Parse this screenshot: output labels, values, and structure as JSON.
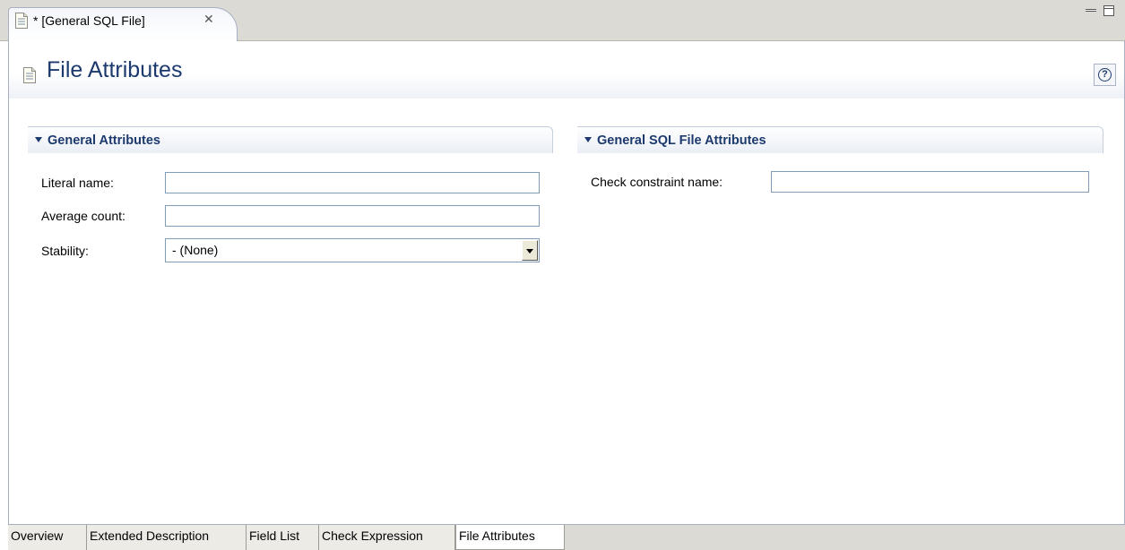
{
  "editor_tab": {
    "title": "* [General SQL File]",
    "close_glyph": "✕"
  },
  "view_controls": {
    "minimize_icon": "minimize-icon",
    "maximize_icon": "maximize-icon"
  },
  "header": {
    "title": "File Attributes",
    "help_glyph": "?"
  },
  "general_attributes": {
    "title": "General Attributes",
    "literal_name": {
      "label": "Literal name:",
      "value": ""
    },
    "average_count": {
      "label": "Average count:",
      "value": ""
    },
    "stability": {
      "label": "Stability:",
      "value": "- (None)"
    }
  },
  "sql_file_attributes": {
    "title": "General SQL File Attributes",
    "check_constraint_name": {
      "label": "Check constraint name:",
      "value": ""
    }
  },
  "page_tabs": [
    "Overview",
    "Extended Description",
    "Field List",
    "Check Expression",
    "File Attributes"
  ],
  "active_page_tab": "File Attributes",
  "colors": {
    "title_blue": "#1c3a6e",
    "tab_bar": "#dcdad5",
    "border": "#a7b0c2"
  }
}
